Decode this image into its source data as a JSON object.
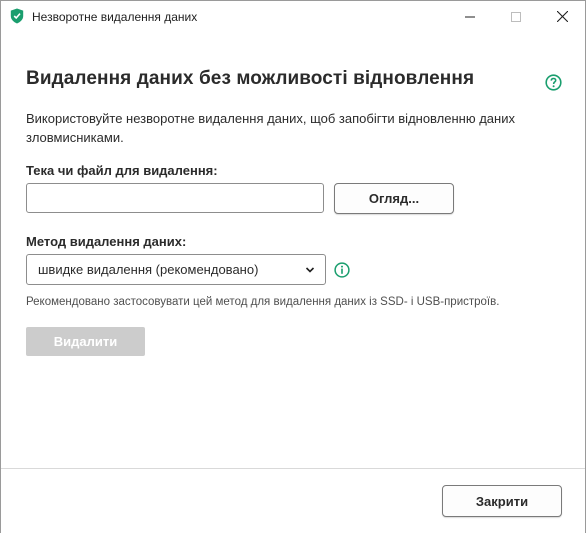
{
  "window": {
    "title": "Незворотне видалення даних",
    "icon": "kaspersky-shield-icon",
    "controls": [
      "minimize-icon",
      "maximize-icon",
      "close-icon"
    ]
  },
  "main": {
    "heading": "Видалення даних без можливості відновлення",
    "description": "Використовуйте незворотне видалення даних, щоб запобігти відновленню даних зловмисниками.",
    "folder_label": "Тека чи файл для видалення:",
    "folder_value": "",
    "browse_label": "Огляд...",
    "method_label": "Метод видалення даних:",
    "method_selected": "швидке видалення (рекомендовано)",
    "hint": "Рекомендовано застосовувати цей метод для видалення даних із SSD- і USB-пристроїв.",
    "delete_label": "Видалити"
  },
  "footer": {
    "close_label": "Закрити"
  },
  "colors": {
    "accent": "#1a9e6e",
    "disabled_button": "#cccccc"
  }
}
